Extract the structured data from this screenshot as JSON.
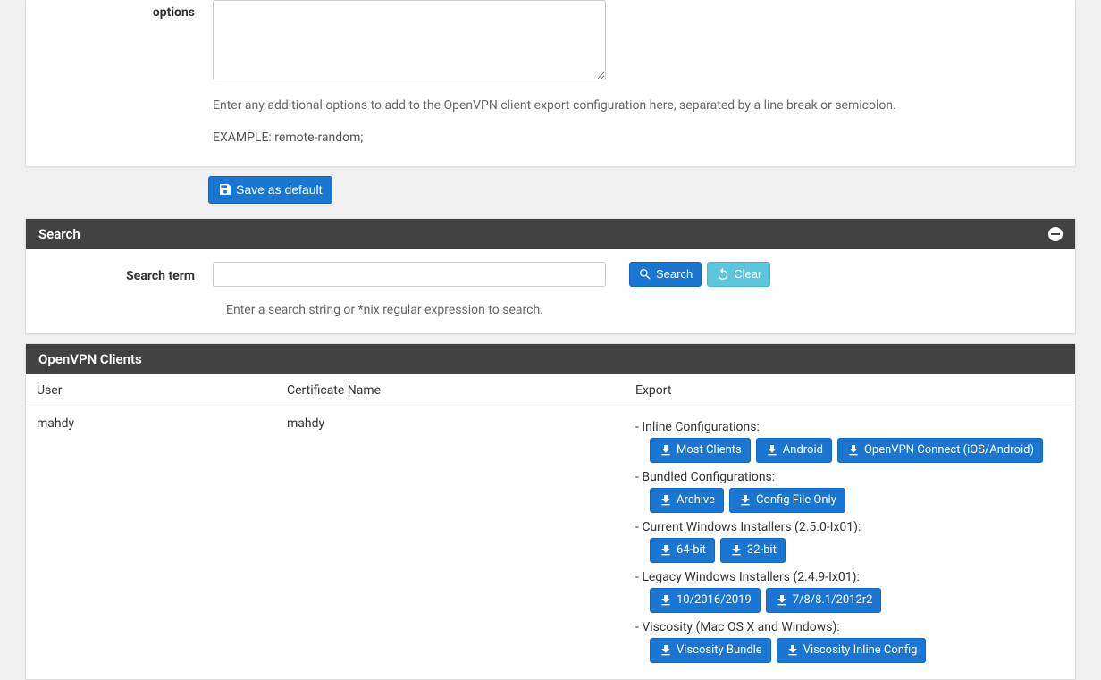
{
  "options": {
    "label": "options",
    "value": "",
    "help": "Enter any additional options to add to the OpenVPN client export configuration here, separated by a line break or semicolon.",
    "example": "EXAMPLE: remote-random;"
  },
  "save_button": "Save as default",
  "search_panel": {
    "title": "Search",
    "term_label": "Search term",
    "term_value": "",
    "search_btn": "Search",
    "clear_btn": "Clear",
    "help": "Enter a search string or *nix regular expression to search."
  },
  "clients_panel": {
    "title": "OpenVPN Clients",
    "columns": {
      "user": "User",
      "cert": "Certificate Name",
      "export": "Export"
    },
    "rows": [
      {
        "user": "mahdy",
        "cert": "mahdy",
        "export_groups": [
          {
            "label": "Inline Configurations:",
            "buttons": [
              "Most Clients",
              "Android",
              "OpenVPN Connect (iOS/Android)"
            ]
          },
          {
            "label": "Bundled Configurations:",
            "buttons": [
              "Archive",
              "Config File Only"
            ]
          },
          {
            "label": "Current Windows Installers (2.5.0-Ix01):",
            "buttons": [
              "64-bit",
              "32-bit"
            ]
          },
          {
            "label": "Legacy Windows Installers (2.4.9-Ix01):",
            "buttons": [
              "10/2016/2019",
              "7/8/8.1/2012r2"
            ]
          },
          {
            "label": "Viscosity (Mac OS X and Windows):",
            "buttons": [
              "Viscosity Bundle",
              "Viscosity Inline Config"
            ]
          }
        ]
      }
    ]
  }
}
